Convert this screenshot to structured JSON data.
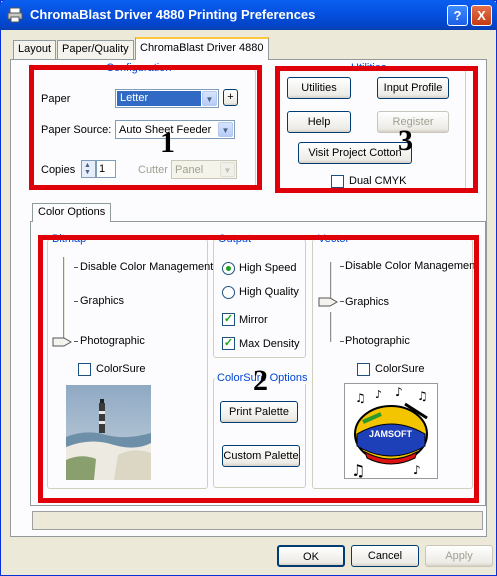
{
  "window": {
    "title": "ChromaBlast Driver 4880 Printing Preferences",
    "help_glyph": "?",
    "close_glyph": "X"
  },
  "tabs": [
    {
      "label": "Layout",
      "active": false
    },
    {
      "label": "Paper/Quality",
      "active": false
    },
    {
      "label": "ChromaBlast Driver 4880",
      "active": true
    }
  ],
  "configuration": {
    "group_label": "Configuration",
    "paper_label": "Paper",
    "paper_value": "Letter",
    "plus_label": "+",
    "source_label": "Paper Source:",
    "source_value": "Auto Sheet Feeder",
    "copies_label": "Copies",
    "copies_value": "1",
    "cutter_label": "Cutter",
    "cutter_value": "Panel"
  },
  "utilities": {
    "group_label": "Utilities",
    "utilities_button": "Utilities",
    "input_profile_button": "Input Profile",
    "help_button": "Help",
    "register_button": "Register",
    "visit_button": "Visit Project Cotton",
    "dual_cmyk_label": "Dual CMYK",
    "dual_cmyk_checked": false
  },
  "color_options_tab": "Color Options",
  "bitmap": {
    "group_label": "Bitmap",
    "level_disable": "Disable Color Management",
    "level_graphics": "Graphics",
    "level_photographic": "Photographic",
    "selected_level": "Photographic",
    "colorsure_label": "ColorSure",
    "colorsure_checked": false
  },
  "output": {
    "group_label": "Output",
    "high_speed": "High Speed",
    "high_quality": "High Quality",
    "selected": "High Speed",
    "mirror": "Mirror",
    "mirror_checked": true,
    "max_density": "Max Density",
    "max_density_checked": true
  },
  "colorsure_options": {
    "group_label": "ColorSure Options",
    "print_palette_button": "Print Palette",
    "custom_palette_button": "Custom Palette"
  },
  "vector": {
    "group_label": "Vector",
    "level_disable": "Disable Color Management",
    "level_graphics": "Graphics",
    "level_photographic": "Photographic",
    "selected_level": "Graphics",
    "colorsure_label": "ColorSure",
    "colorsure_checked": false
  },
  "vector_logo_text": "JAMSOFT",
  "annotations": {
    "one": "1",
    "two": "2",
    "three": "3"
  },
  "buttons": {
    "ok": "OK",
    "cancel": "Cancel",
    "apply": "Apply"
  },
  "colors": {
    "title_bar": "#0550E0",
    "highlight": "#E0000A",
    "group_label": "#0046D5",
    "selected_combo": "#316AC5"
  }
}
